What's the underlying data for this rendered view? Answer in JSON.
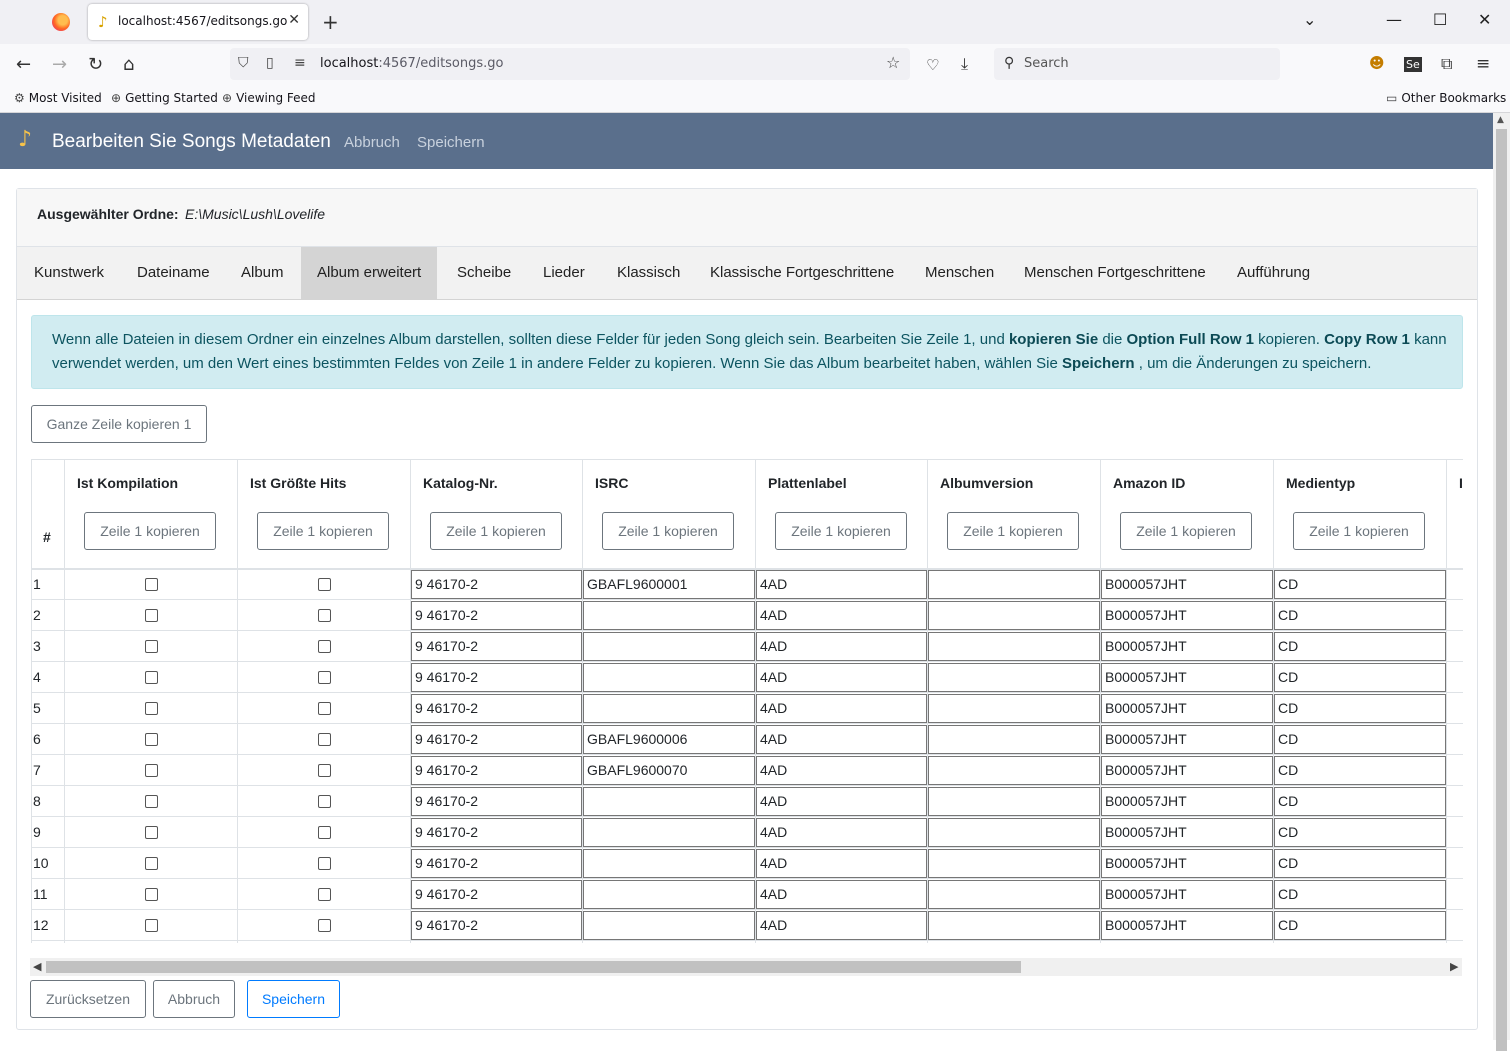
{
  "browser": {
    "tab_title": "localhost:4567/editsongs.go",
    "url_host": "localhost",
    "url_rest": ":4567/editsongs.go",
    "search_placeholder": "Search",
    "bookmarks": [
      "Most Visited",
      "Getting Started",
      "Viewing Feed"
    ],
    "other_bookmarks": "Other Bookmarks"
  },
  "app": {
    "title": "Bearbeiten Sie Songs Metadaten",
    "cancel_link": "Abbruch",
    "save_link": "Speichern"
  },
  "folder": {
    "label": "Ausgewählter Ordne:",
    "path": "E:\\Music\\Lush\\Lovelife"
  },
  "tabs": [
    "Kunstwerk",
    "Dateiname",
    "Album",
    "Album erweitert",
    "Scheibe",
    "Lieder",
    "Klassisch",
    "Klassische Fortgeschrittene",
    "Menschen",
    "Menschen Fortgeschrittene",
    "Aufführung"
  ],
  "active_tab": "Album erweitert",
  "info": {
    "l1_a": "Wenn alle Dateien in diesem Ordner ein einzelnes Album darstellen, sollten diese Felder für jeden Song gleich sein. Bearbeiten Sie Zeile 1, und ",
    "l1_b": "kopieren Sie",
    "l1_c": " die ",
    "l1_d": "Option Full Row 1",
    "l1_e": " kopieren. ",
    "l1_f": "Copy Row 1",
    "l1_g": " kann",
    "l2_a": "verwendet werden, um den Wert eines bestimmten Feldes von Zeile 1 in andere Felder zu kopieren. Wenn Sie das Album bearbeitet haben, wählen Sie ",
    "l2_b": "Speichern",
    "l2_c": " , um die Änderungen zu speichern."
  },
  "copy_full_row_button": "Ganze Zeile kopieren 1",
  "table": {
    "num_header": "#",
    "copy_label": "Zeile 1 kopieren",
    "columns": [
      "Ist Kompilation",
      "Ist Größte Hits",
      "Katalog-Nr.",
      "ISRC",
      "Plattenlabel",
      "Albumversion",
      "Amazon ID",
      "Medientyp",
      "I"
    ],
    "rows": [
      {
        "num": "1",
        "kompilation": false,
        "hits": false,
        "katalog": "9 46170-2",
        "isrc": "GBAFL9600001",
        "label": "4AD",
        "version": "",
        "amazon": "B000057JHT",
        "medium": "CD"
      },
      {
        "num": "2",
        "kompilation": false,
        "hits": false,
        "katalog": "9 46170-2",
        "isrc": "",
        "label": "4AD",
        "version": "",
        "amazon": "B000057JHT",
        "medium": "CD"
      },
      {
        "num": "3",
        "kompilation": false,
        "hits": false,
        "katalog": "9 46170-2",
        "isrc": "",
        "label": "4AD",
        "version": "",
        "amazon": "B000057JHT",
        "medium": "CD"
      },
      {
        "num": "4",
        "kompilation": false,
        "hits": false,
        "katalog": "9 46170-2",
        "isrc": "",
        "label": "4AD",
        "version": "",
        "amazon": "B000057JHT",
        "medium": "CD"
      },
      {
        "num": "5",
        "kompilation": false,
        "hits": false,
        "katalog": "9 46170-2",
        "isrc": "",
        "label": "4AD",
        "version": "",
        "amazon": "B000057JHT",
        "medium": "CD"
      },
      {
        "num": "6",
        "kompilation": false,
        "hits": false,
        "katalog": "9 46170-2",
        "isrc": "GBAFL9600006",
        "label": "4AD",
        "version": "",
        "amazon": "B000057JHT",
        "medium": "CD"
      },
      {
        "num": "7",
        "kompilation": false,
        "hits": false,
        "katalog": "9 46170-2",
        "isrc": "GBAFL9600070",
        "label": "4AD",
        "version": "",
        "amazon": "B000057JHT",
        "medium": "CD"
      },
      {
        "num": "8",
        "kompilation": false,
        "hits": false,
        "katalog": "9 46170-2",
        "isrc": "",
        "label": "4AD",
        "version": "",
        "amazon": "B000057JHT",
        "medium": "CD"
      },
      {
        "num": "9",
        "kompilation": false,
        "hits": false,
        "katalog": "9 46170-2",
        "isrc": "",
        "label": "4AD",
        "version": "",
        "amazon": "B000057JHT",
        "medium": "CD"
      },
      {
        "num": "10",
        "kompilation": false,
        "hits": false,
        "katalog": "9 46170-2",
        "isrc": "",
        "label": "4AD",
        "version": "",
        "amazon": "B000057JHT",
        "medium": "CD"
      },
      {
        "num": "11",
        "kompilation": false,
        "hits": false,
        "katalog": "9 46170-2",
        "isrc": "",
        "label": "4AD",
        "version": "",
        "amazon": "B000057JHT",
        "medium": "CD"
      },
      {
        "num": "12",
        "kompilation": false,
        "hits": false,
        "katalog": "9 46170-2",
        "isrc": "",
        "label": "4AD",
        "version": "",
        "amazon": "B000057JHT",
        "medium": "CD"
      }
    ]
  },
  "footer": {
    "reset": "Zurücksetzen",
    "cancel": "Abbruch",
    "save": "Speichern"
  }
}
